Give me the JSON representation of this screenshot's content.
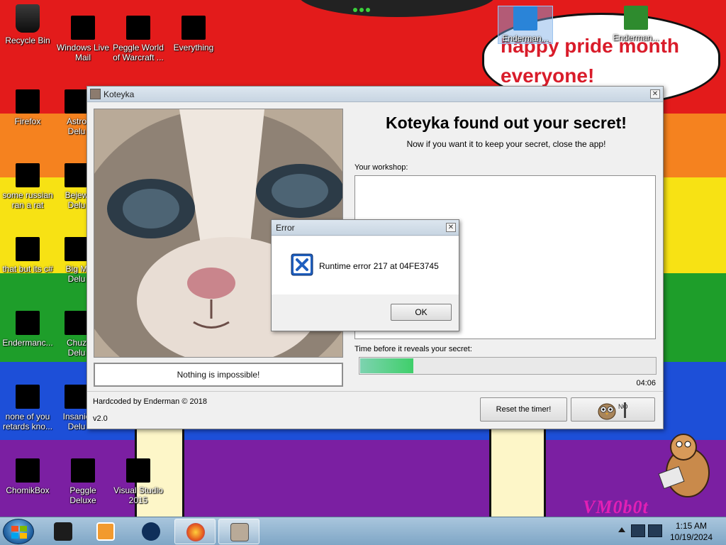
{
  "desktop": {
    "speech_bubble": "happy pride month everyone!",
    "wallpaper_signature": "VM0b0t",
    "colors": {
      "red": "#e31b1b",
      "orange": "#f5821f",
      "yellow": "#f7e214",
      "green": "#1e9e2a",
      "blue": "#1d4fd8",
      "purple": "#7b1fa2"
    },
    "icons": [
      {
        "label": "Recycle Bin",
        "icon": "recycle-bin-icon"
      },
      {
        "label": "Windows Live Mail",
        "icon": "mail-icon"
      },
      {
        "label": "Peggle World of Warcraft ...",
        "icon": "peggle-icon"
      },
      {
        "label": "Everything",
        "icon": "search-icon"
      },
      {
        "label": "Enderman...",
        "icon": "windows-logo-icon"
      },
      {
        "label": "Enderman...",
        "icon": "dragon-icon"
      },
      {
        "label": "Firefox",
        "icon": "firefox-icon"
      },
      {
        "label": "Astro Delu",
        "icon": "game-icon"
      },
      {
        "label": "some russian ran a rat",
        "icon": "document-icon"
      },
      {
        "label": "Bejew Delu",
        "icon": "game-icon"
      },
      {
        "label": "that but its c#",
        "icon": "windows-stack-icon"
      },
      {
        "label": "Big M Delu",
        "icon": "game-icon"
      },
      {
        "label": "Endermanc...",
        "icon": "terminal-icon"
      },
      {
        "label": "Chuz Delu",
        "icon": "game-icon"
      },
      {
        "label": "none of you retards kno...",
        "icon": "ring-icon"
      },
      {
        "label": "Insanio Delu",
        "icon": "game-icon"
      },
      {
        "label": "ChomikBox",
        "icon": "hamster-icon"
      },
      {
        "label": "Peggle Deluxe",
        "icon": "peggle-icon"
      },
      {
        "label": "Visual Studio 2015",
        "icon": "visual-studio-icon"
      }
    ]
  },
  "app_window": {
    "title": "Koteyka",
    "heading": "Koteyka found out your secret!",
    "subheading": "Now if you want it to keep your secret, close the app!",
    "workshop_label": "Your workshop:",
    "caption": "Nothing is impossible!",
    "timer_label": "Time before it reveals your secret:",
    "timer_progress": 0.18,
    "timer_value": "04:06",
    "credit": "Hardcoded by Enderman © 2018",
    "version": "v2.0",
    "reset_button": "Reset the timer!",
    "owl_button_icon": "owl-icon"
  },
  "error_dialog": {
    "title": "Error",
    "message": "Runtime error 217 at 04FE3745",
    "ok_button": "OK",
    "icon": "error-x-icon"
  },
  "taskbar": {
    "items": [
      {
        "name": "start-button",
        "icon": "windows-orb-icon"
      },
      {
        "name": "taskbar-item-1",
        "icon": "black-box-icon"
      },
      {
        "name": "taskbar-item-2",
        "icon": "media-player-icon"
      },
      {
        "name": "taskbar-item-3",
        "icon": "globe-icon"
      },
      {
        "name": "taskbar-item-4",
        "icon": "firefox-icon"
      },
      {
        "name": "taskbar-item-5",
        "icon": "koteyka-icon"
      }
    ],
    "clock": {
      "time": "1:15 AM",
      "date": "10/19/2024"
    }
  }
}
